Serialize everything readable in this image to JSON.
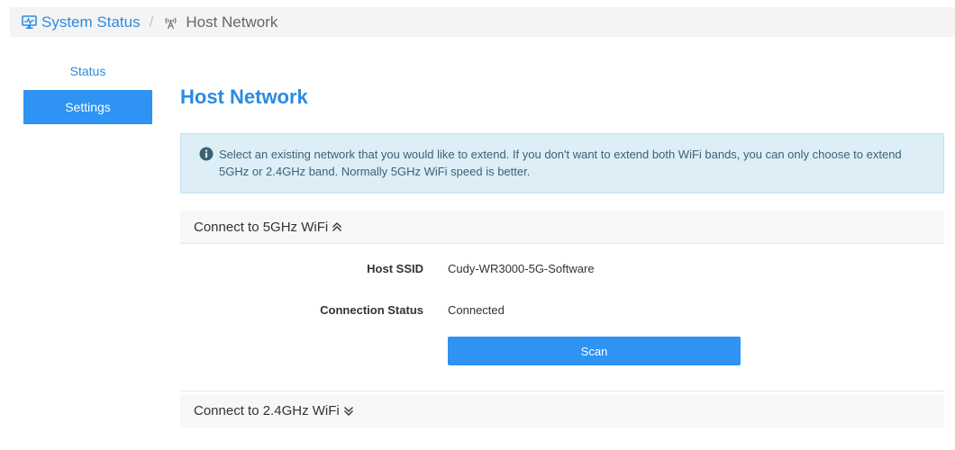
{
  "breadcrumb": {
    "root_label": "System Status",
    "root_icon": "monitor-icon",
    "separator": "/",
    "current_label": "Host Network",
    "current_icon": "antenna-icon"
  },
  "sidebar": {
    "items": [
      {
        "label": "Status",
        "active": false
      },
      {
        "label": "Settings",
        "active": true
      }
    ]
  },
  "main": {
    "title": "Host Network",
    "alert": {
      "icon": "info-icon",
      "line1": "Select an existing network that you would like to extend. If you don't want to extend both WiFi bands, you can only choose to extend",
      "line2": "5GHz or 2.4GHz band. Normally 5GHz WiFi speed is better."
    },
    "section_5g": {
      "title": "Connect to 5GHz WiFi",
      "expanded": true,
      "ssid_label": "Host SSID",
      "ssid_value": "Cudy-WR3000-5G-Software",
      "status_label": "Connection Status",
      "status_value": "Connected",
      "scan_label": "Scan"
    },
    "section_24g": {
      "title": "Connect to 2.4GHz WiFi",
      "expanded": false
    }
  },
  "colors": {
    "accent": "#2e93f2",
    "link": "#2b8be0",
    "alert_bg": "#ddeef7",
    "alert_text": "#3b6274"
  }
}
